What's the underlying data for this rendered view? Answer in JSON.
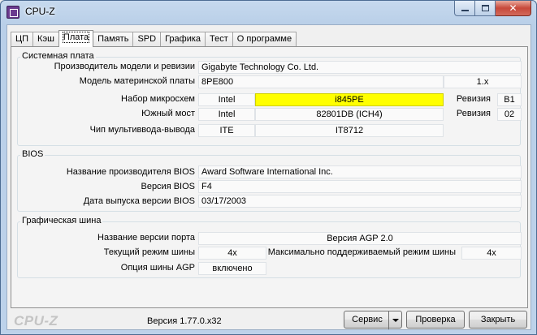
{
  "window": {
    "title": "CPU-Z"
  },
  "tabs": [
    {
      "label": "ЦП"
    },
    {
      "label": "Кэш"
    },
    {
      "label": "Плата"
    },
    {
      "label": "Память"
    },
    {
      "label": "SPD"
    },
    {
      "label": "Графика"
    },
    {
      "label": "Тест"
    },
    {
      "label": "О программе"
    }
  ],
  "active_tab": "Плата",
  "motherboard": {
    "legend": "Системная плата",
    "manufacturer_label": "Производитель модели и ревизии",
    "manufacturer_value": "Gigabyte Technology Co. Ltd.",
    "model_label": "Модель материнской платы",
    "model_value": "8PE800",
    "model_revision": "1.x",
    "chipset_label": "Набор микросхем",
    "chipset_vendor": "Intel",
    "chipset_model": "i845PE",
    "chipset_rev_label": "Ревизия",
    "chipset_rev": "B1",
    "southbridge_label": "Южный мост",
    "southbridge_vendor": "Intel",
    "southbridge_model": "82801DB (ICH4)",
    "southbridge_rev_label": "Ревизия",
    "southbridge_rev": "02",
    "lpcio_label": "Чип мультиввода-вывода",
    "lpcio_vendor": "ITE",
    "lpcio_model": "IT8712"
  },
  "bios": {
    "legend": "BIOS",
    "brand_label": "Название производителя BIOS",
    "brand_value": "Award Software International Inc.",
    "version_label": "Версия BIOS",
    "version_value": "F4",
    "date_label": "Дата выпуска версии BIOS",
    "date_value": "03/17/2003"
  },
  "graphic": {
    "legend": "Графическая шина",
    "version_label": "Название версии порта",
    "version_value": "Версия AGP 2.0",
    "current_label": "Текущий режим шины",
    "current_value": "4x",
    "max_label": "Максимально поддерживаемый режим шины",
    "max_value": "4x",
    "agp_label": "Опция шины AGP",
    "agp_value": "включено"
  },
  "footer": {
    "brand": "CPU-Z",
    "version": "Версия 1.77.0.x32",
    "service_label": "Сервис",
    "validate_label": "Проверка",
    "close_label": "Закрыть"
  }
}
